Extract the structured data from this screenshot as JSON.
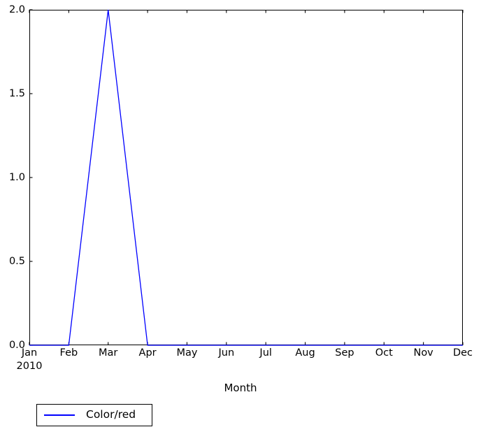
{
  "chart_data": {
    "type": "line",
    "title": "",
    "xlabel": "Month",
    "ylabel": "",
    "grid": false,
    "legend_position": "below-left",
    "xlim": [
      0,
      11
    ],
    "ylim": [
      0.0,
      2.0
    ],
    "categories": [
      "Jan",
      "Feb",
      "Mar",
      "Apr",
      "May",
      "Jun",
      "Jul",
      "Aug",
      "Sep",
      "Oct",
      "Nov",
      "Dec"
    ],
    "x_year_label": "2010",
    "x_tick_labels": [
      "Jan",
      "Feb",
      "Mar",
      "Apr",
      "May",
      "Jun",
      "Jul",
      "Aug",
      "Sep",
      "Oct",
      "Nov",
      "Dec"
    ],
    "y_tick_labels": [
      "0.0",
      "0.5",
      "1.0",
      "1.5",
      "2.0"
    ],
    "y_tick_values": [
      0.0,
      0.5,
      1.0,
      1.5,
      2.0
    ],
    "series": [
      {
        "name": "Color/red",
        "color": "#0000ff",
        "values": [
          0,
          0,
          2,
          0,
          0,
          0,
          0,
          0,
          0,
          0,
          0,
          0
        ]
      }
    ],
    "legend": [
      "Color/red"
    ],
    "annotations": []
  },
  "axis": {
    "x_title": "Month",
    "year": "2010"
  },
  "legend": {
    "entries": [
      {
        "label": "Color/red",
        "color": "#0000ff"
      }
    ]
  },
  "colors": {
    "series_blue": "#0000ff",
    "axis_black": "#000000",
    "background": "#ffffff"
  }
}
